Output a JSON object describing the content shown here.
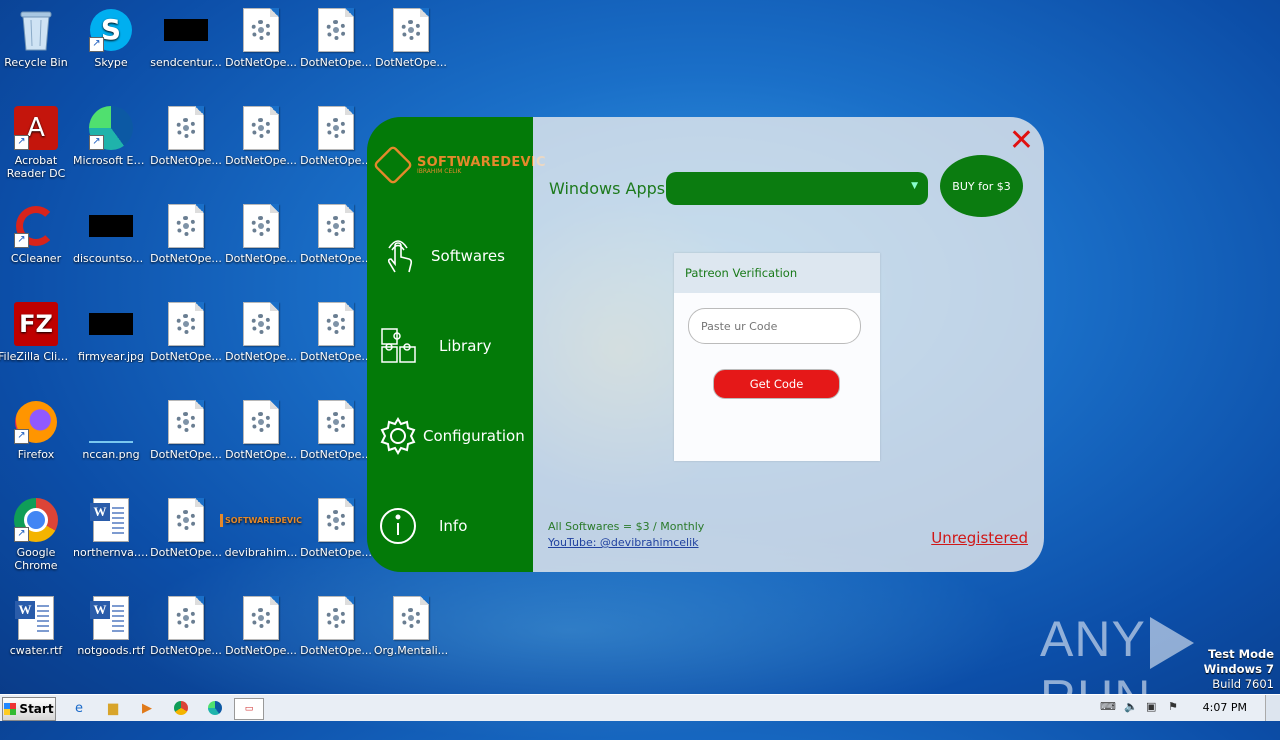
{
  "desktop": {
    "icons": [
      {
        "label": "Recycle Bin",
        "icon": "recycle-bin-icon"
      },
      {
        "label": "Skype",
        "icon": "skype-icon"
      },
      {
        "label": "sendcentur...",
        "icon": "black-image-icon"
      },
      {
        "label": "DotNetOpe...",
        "icon": "config-file-icon"
      },
      {
        "label": "DotNetOpe...",
        "icon": "config-file-icon"
      },
      {
        "label": "DotNetOpe...",
        "icon": "config-file-icon"
      },
      {
        "label": "Acrobat Reader DC",
        "icon": "acrobat-icon"
      },
      {
        "label": "Microsoft Edge",
        "icon": "edge-icon"
      },
      {
        "label": "DotNetOpe...",
        "icon": "config-file-icon"
      },
      {
        "label": "DotNetOpe...",
        "icon": "config-file-icon"
      },
      {
        "label": "DotNetOpe...",
        "icon": "config-file-icon"
      },
      {
        "label": "CCleaner",
        "icon": "ccleaner-icon"
      },
      {
        "label": "discountsom...",
        "icon": "black-image-icon"
      },
      {
        "label": "DotNetOpe...",
        "icon": "config-file-icon"
      },
      {
        "label": "DotNetOpe...",
        "icon": "config-file-icon"
      },
      {
        "label": "DotNetOpe...",
        "icon": "config-file-icon"
      },
      {
        "label": "FileZilla Client",
        "icon": "filezilla-icon"
      },
      {
        "label": "firmyear.jpg",
        "icon": "black-image-icon"
      },
      {
        "label": "DotNetOpe...",
        "icon": "config-file-icon"
      },
      {
        "label": "DotNetOpe...",
        "icon": "config-file-icon"
      },
      {
        "label": "DotNetOpe...",
        "icon": "config-file-icon"
      },
      {
        "label": "Firefox",
        "icon": "firefox-icon"
      },
      {
        "label": "nccan.png",
        "icon": "image-icon"
      },
      {
        "label": "DotNetOpe...",
        "icon": "config-file-icon"
      },
      {
        "label": "DotNetOpe...",
        "icon": "config-file-icon"
      },
      {
        "label": "DotNetOpe...",
        "icon": "config-file-icon"
      },
      {
        "label": "Google Chrome",
        "icon": "chrome-icon"
      },
      {
        "label": "northernva.rtf",
        "icon": "word-doc-icon"
      },
      {
        "label": "DotNetOpe...",
        "icon": "config-file-icon"
      },
      {
        "label": "devibrahim...",
        "icon": "softwaredevic-logo-icon"
      },
      {
        "label": "DotNetOpe...",
        "icon": "config-file-icon"
      },
      {
        "label": "cwater.rtf",
        "icon": "word-doc-icon"
      },
      {
        "label": "notgoods.rtf",
        "icon": "word-doc-icon"
      },
      {
        "label": "DotNetOpe...",
        "icon": "config-file-icon"
      },
      {
        "label": "DotNetOpe...",
        "icon": "config-file-icon"
      },
      {
        "label": "DotNetOpe...",
        "icon": "config-file-icon"
      },
      {
        "label": "Org.Mentali...",
        "icon": "config-file-icon"
      }
    ]
  },
  "app": {
    "logo_title": "SOFTWAREDEVIC",
    "logo_subtitle": "IBRAHIM CELIK",
    "nav": [
      {
        "label": "Softwares",
        "icon": "touch-hand-icon"
      },
      {
        "label": "Library",
        "icon": "puzzle-icon"
      },
      {
        "label": "Configuration",
        "icon": "gear-icon"
      },
      {
        "label": "Info",
        "icon": "info-icon"
      }
    ],
    "category_label": "Windows Apps",
    "category_select_value": "",
    "buy_label": "BUY for $3",
    "patreon": {
      "title": "Patreon Verification",
      "placeholder": "Paste ur Code",
      "button": "Get Code"
    },
    "footer_price": "All Softwares = $3 / Monthly",
    "footer_youtube": "YouTube: @devibrahimcelik",
    "status": "Unregistered",
    "colors": {
      "sidebar": "#037a08",
      "accent_orange": "#e4892b",
      "danger_red": "#e51818"
    }
  },
  "taskbar": {
    "start_label": "Start",
    "clock": "4:07 PM",
    "pinned": [
      "ie-icon",
      "explorer-icon",
      "media-player-icon",
      "chrome-icon",
      "edge-icon",
      "app-window-icon"
    ]
  },
  "watermark": {
    "brand_left": "ANY",
    "brand_right": "RUN",
    "line1": "Test Mode",
    "line2": "Windows 7",
    "line3": "Build 7601"
  }
}
